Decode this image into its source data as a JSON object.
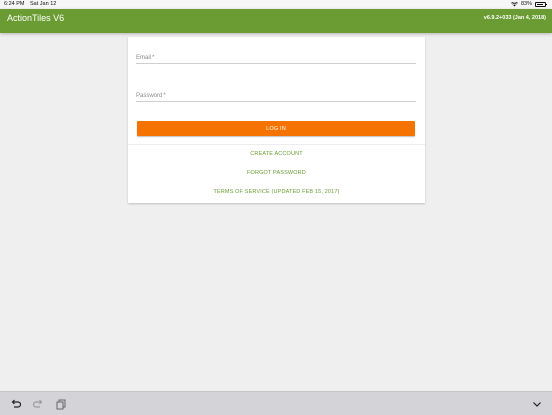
{
  "status_bar": {
    "time": "6:24 PM",
    "date": "Sat Jan 12",
    "battery": "83%"
  },
  "header": {
    "title": "ActionTiles V6",
    "version": "v6.9.2+033 (Jan 4, 2018)",
    "color": "#6a9c33"
  },
  "login": {
    "email_label": "Email",
    "email_value": "",
    "password_label": "Password",
    "password_value": "",
    "required_marker": "*",
    "login_button": "LOG IN",
    "button_color": "#f57300",
    "create_account": "CREATE ACCOUNT",
    "forgot_password": "FORGOT PASSWORD",
    "terms": "TERMS OF SERVICE (UPDATED FEB 15, 2017)"
  },
  "toolbar": {
    "icons": [
      "undo-icon",
      "redo-icon",
      "paste-icon",
      "hide-keyboard-icon"
    ]
  }
}
